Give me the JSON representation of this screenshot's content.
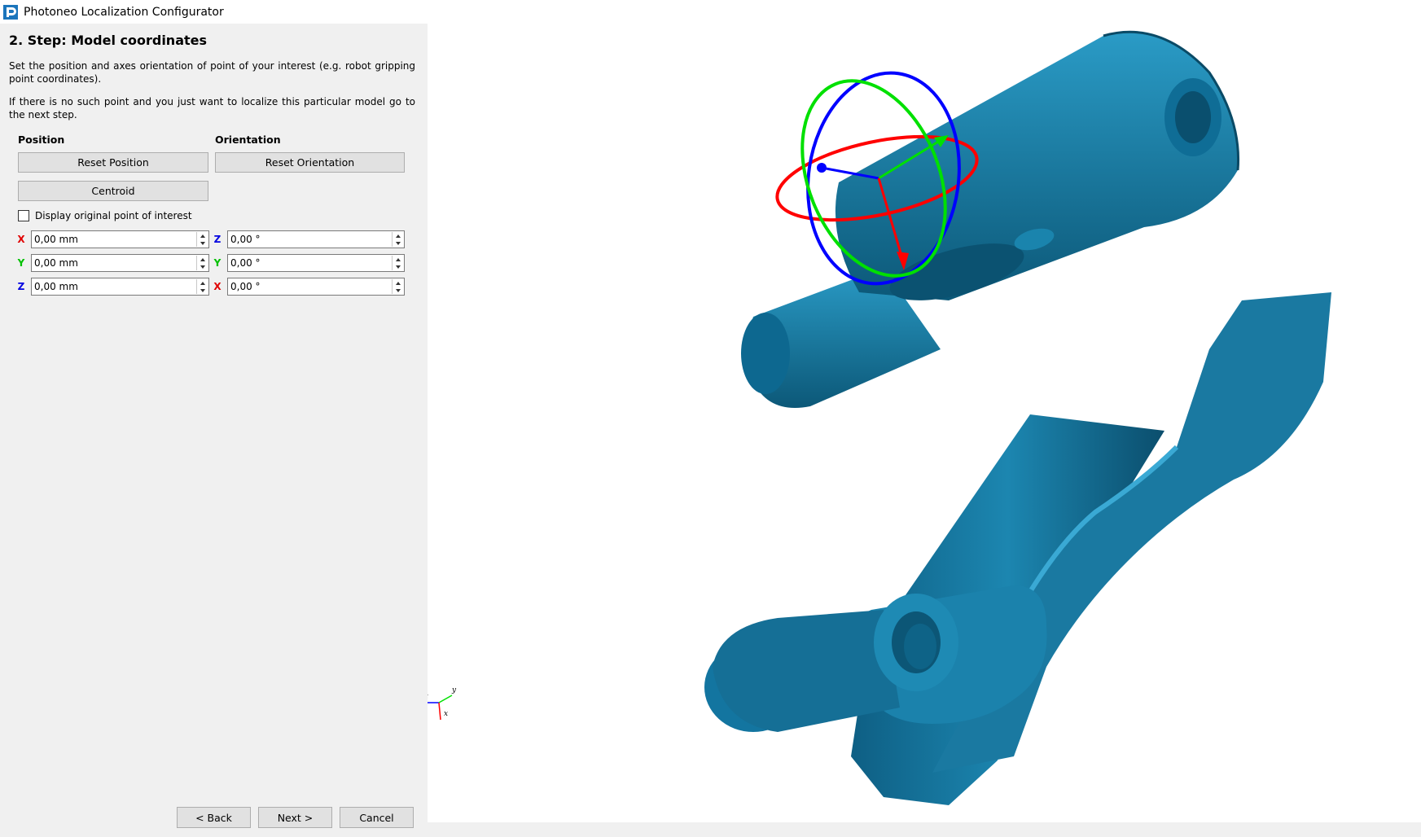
{
  "window": {
    "title": "Photoneo Localization Configurator"
  },
  "step": {
    "title": "2. Step: Model coordinates",
    "desc1": "Set the position and axes orientation of point of your interest (e.g. robot gripping point coordinates).",
    "desc2": "If there is no such point and you just want to localize this particular model go to the next step."
  },
  "position": {
    "label": "Position",
    "reset_label": "Reset Position",
    "centroid_label": "Centroid",
    "fields": [
      {
        "axis": "X",
        "value": "0,00 mm",
        "color": "#e00000"
      },
      {
        "axis": "Y",
        "value": "0,00 mm",
        "color": "#00c000"
      },
      {
        "axis": "Z",
        "value": "0,00 mm",
        "color": "#0000e0"
      }
    ]
  },
  "orientation": {
    "label": "Orientation",
    "reset_label": "Reset Orientation",
    "fields": [
      {
        "axis": "Z",
        "value": "0,00 °",
        "color": "#0000e0"
      },
      {
        "axis": "Y",
        "value": "0,00 °",
        "color": "#00c000"
      },
      {
        "axis": "X",
        "value": "0,00 °",
        "color": "#e00000"
      }
    ]
  },
  "checkbox": {
    "label": "Display original point of interest",
    "checked": false
  },
  "footer": {
    "back_label": "< Back",
    "next_label": "Next >",
    "cancel_label": "Cancel"
  },
  "triad": {
    "z_label": "z",
    "y_label": "y",
    "x_label": "x"
  },
  "colors": {
    "model": "#1a7fa6",
    "model_dark": "#0d5778",
    "x_axis": "#ff0000",
    "y_axis": "#00e000",
    "z_axis": "#0000ff"
  }
}
